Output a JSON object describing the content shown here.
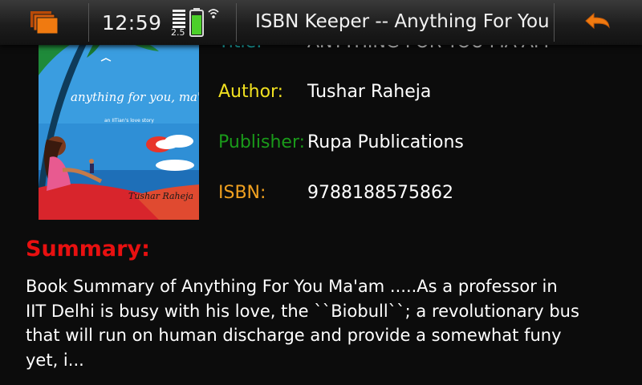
{
  "status_bar": {
    "time": "12:59",
    "network_type": "2.5",
    "app_title": "ISBN Keeper -- Anything For You Ma'am",
    "icons": [
      "task-switcher-icon",
      "signal-icon",
      "battery-icon",
      "wifi-icon",
      "back-arrow-icon"
    ]
  },
  "book": {
    "title_label": "Title:",
    "title_value": "ANYTHING FOR YOU MA'AM",
    "author_label": "Author:",
    "author_value": "Tushar Raheja",
    "publisher_label": "Publisher:",
    "publisher_value": "Rupa Publications",
    "isbn_label": "ISBN:",
    "isbn_value": "9788188575862"
  },
  "cover": {
    "title": "anything for you, ma'am",
    "subtitle": "an IITian's love story",
    "author": "Tushar Raheja"
  },
  "summary": {
    "heading": "Summary:",
    "text": "Book Summary of Anything For You Ma'am .....As a professor in IIT Delhi is busy with his love, the ``Biobull``; a revolutionary bus that will run on human discharge and provide a somewhat funy yet, i..."
  },
  "colors": {
    "title_label": "#20c8c8",
    "author_label": "#f0e020",
    "publisher_label": "#1a9a1a",
    "isbn_label": "#f0a020",
    "summary_heading": "#e81010",
    "accent": "#f07a10"
  }
}
